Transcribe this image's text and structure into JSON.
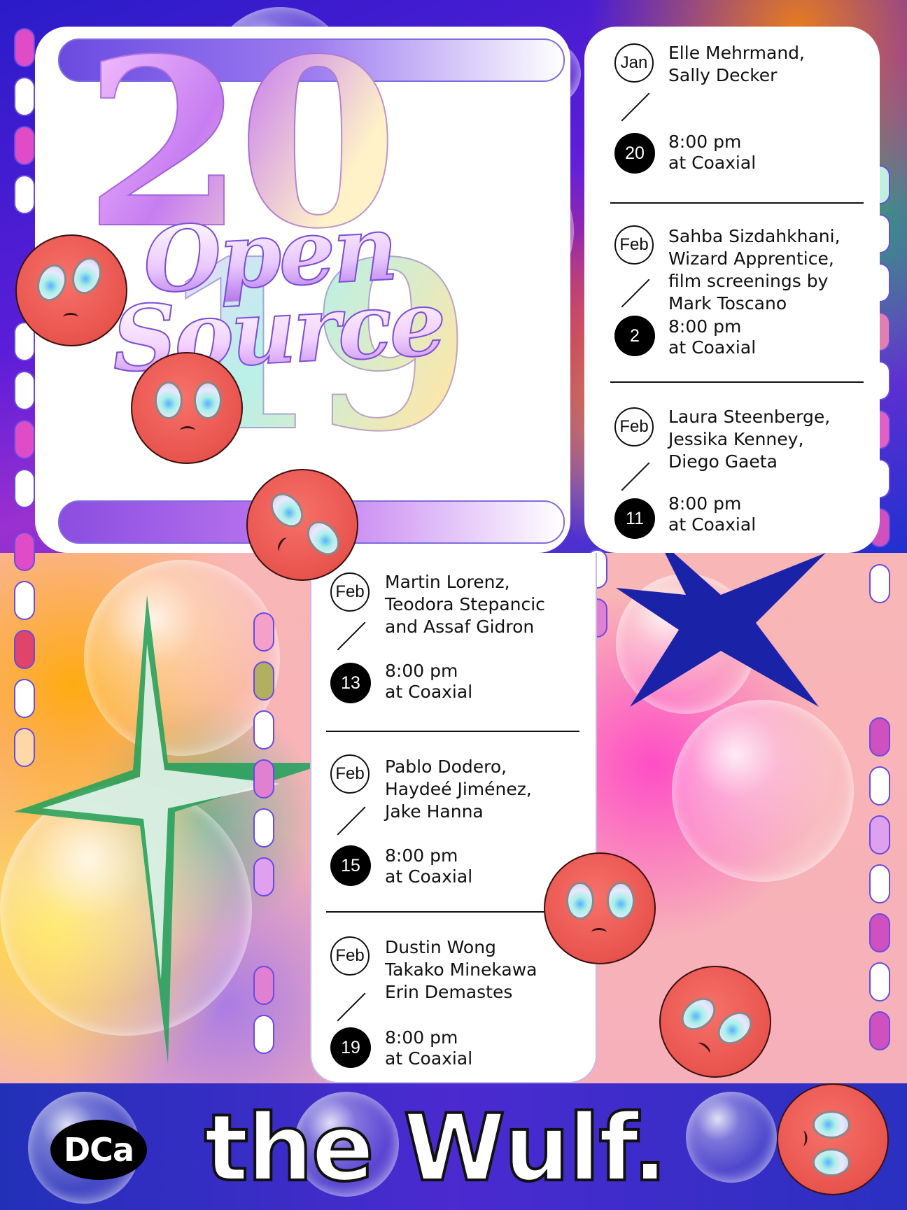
{
  "title": {
    "year_top": "20",
    "year_bottom": "19",
    "word1": "Open",
    "word2": "Source"
  },
  "events": [
    {
      "month": "Jan",
      "day": "20",
      "names": "Elle Mehrmand,\nSally Decker",
      "time": "8:00 pm",
      "venue": "at Coaxial"
    },
    {
      "month": "Feb",
      "day": "2",
      "names": "Sahba Sizdahkhani,\nWizard Apprentice,\nfilm screenings by\nMark Toscano",
      "time": "8:00 pm",
      "venue": "at Coaxial"
    },
    {
      "month": "Feb",
      "day": "11",
      "names": "Laura Steenberge,\nJessika Kenney,\nDiego Gaeta",
      "time": "8:00 pm",
      "venue": "at Coaxial"
    },
    {
      "month": "Feb",
      "day": "13",
      "names": "Martin Lorenz,\nTeodora Stepancic\nand Assaf Gidron",
      "time": "8:00 pm",
      "venue": "at Coaxial"
    },
    {
      "month": "Feb",
      "day": "15",
      "names": "Pablo Dodero,\nHaydeé Jiménez,\nJake Hanna",
      "time": "8:00 pm",
      "venue": "at Coaxial"
    },
    {
      "month": "Feb",
      "day": "19",
      "names": "Dustin Wong\nTakako Minekawa\nErin Demastes",
      "time": "8:00 pm",
      "venue": "at Coaxial"
    }
  ],
  "footer": {
    "logo": "DCa",
    "venue": "the Wulf."
  },
  "colors": {
    "face": "#e8544e",
    "footer_bg": "#2230b8",
    "card": "#ffffff"
  }
}
